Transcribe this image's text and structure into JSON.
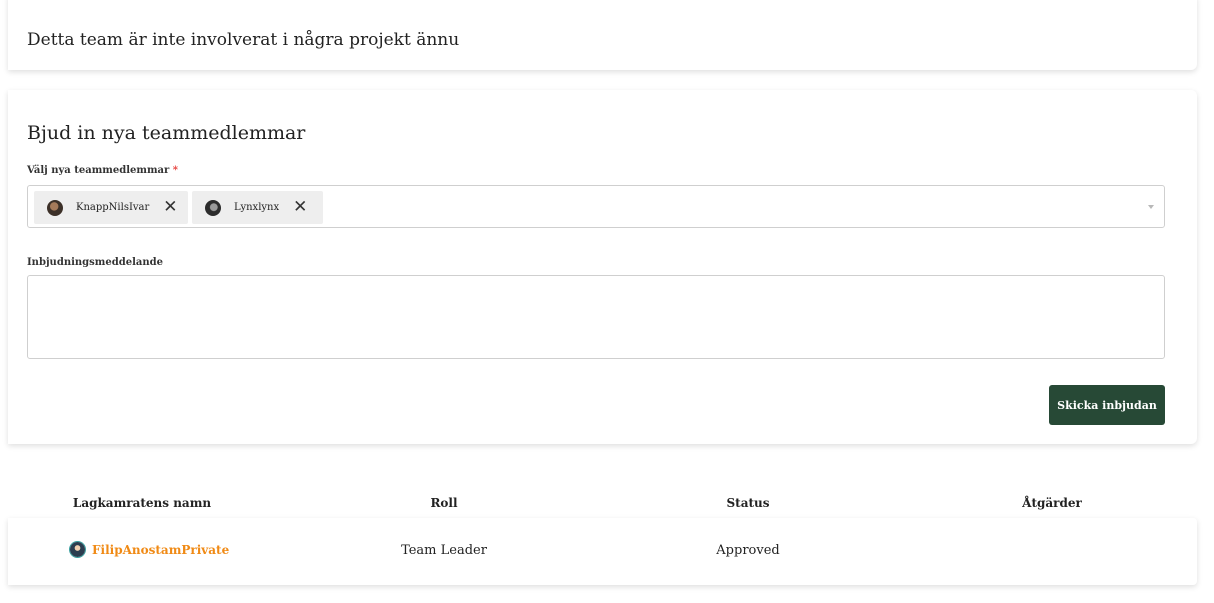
{
  "projects_card": {
    "empty_message": "Detta team är inte involverat i några projekt ännu"
  },
  "invite_card": {
    "title": "Bjud in nya teammedlemmar",
    "members_label": "Välj nya teammedlemmar",
    "required_mark": "*",
    "selected_members": [
      {
        "name": "KnappNilsIvar",
        "avatar_icon": "user-avatar",
        "remove_icon": "close-icon"
      },
      {
        "name": "Lynxlynx",
        "avatar_icon": "user-avatar",
        "remove_icon": "close-icon"
      }
    ],
    "message_label": "Inbjudningsmeddelande",
    "message_value": "",
    "send_label": "Skicka inbjudan"
  },
  "members_table": {
    "columns": [
      "Lagkamratens namn",
      "Roll",
      "Status",
      "Åtgärder"
    ],
    "rows": [
      {
        "name": "FilipAnostamPrivate",
        "role": "Team Leader",
        "status": "Approved",
        "actions": ""
      }
    ]
  },
  "colors": {
    "primary_button": "#274936",
    "member_link": "#f08a15",
    "required": "#e53935"
  }
}
